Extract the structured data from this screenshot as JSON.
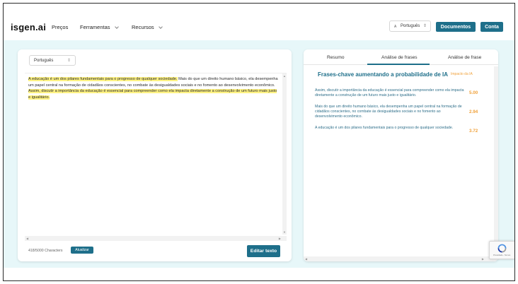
{
  "navbar": {
    "logo": "isgen.ai",
    "links": [
      {
        "label": "Preços"
      },
      {
        "label": "Ferramentas"
      },
      {
        "label": "Recursos"
      }
    ],
    "language": "Português",
    "language_icon": "translate-icon",
    "documents_button": "Documentos",
    "account_button": "Conta",
    "accent_color": "#1e6f8a"
  },
  "editor": {
    "language": "Português",
    "text_segments": [
      {
        "text": "A educação é um dos pilares fundamentais para o progresso de qualquer sociedade.",
        "highlight": true
      },
      {
        "text": " Mais do que um direito humano básico, ela desempenha um papel central na formação de cidadãos conscientes, no combate às desigualdades sociais e no fomento ao desenvolvimento econômico. ",
        "highlight": false
      },
      {
        "text": "Assim, discutir a importância da educação é essencial para compreender como ela impacta diretamente a construção de um futuro mais justo e igualitário.",
        "highlight": true
      }
    ],
    "highlight_color": "#fff383",
    "char_count": "418/5000 Characters",
    "refresh_button": "Atualizar",
    "edit_button": "Editar texto"
  },
  "analysis": {
    "tabs": [
      {
        "label": "Resumo"
      },
      {
        "label": "Análise de frases"
      },
      {
        "label": "Análise de frase"
      }
    ],
    "active_tab": "Análise de frases",
    "title": "Frases-chave aumentando a probabilidade de IA",
    "impact_label": "Impacto da IA",
    "impact_color": "#f0a13a",
    "phrases": [
      {
        "text": "Assim, discutir a importância da educação é essencial para compreender como ela impacta diretamente a construção de um futuro mais justo e igualitário.",
        "score": "5.00"
      },
      {
        "text": "Mais do que um direito humano básico, ela desempenha um papel central na formação de cidadãos conscientes, no combate às desigualdades sociais e no fomento ao desenvolvimento econômico.",
        "score": "2.94"
      },
      {
        "text": "A educação é um dos pilares fundamentais para o progresso de qualquer sociedade.",
        "score": "3.72"
      }
    ]
  },
  "recaptcha": {
    "footer_text": "Privacidade - Termos"
  }
}
